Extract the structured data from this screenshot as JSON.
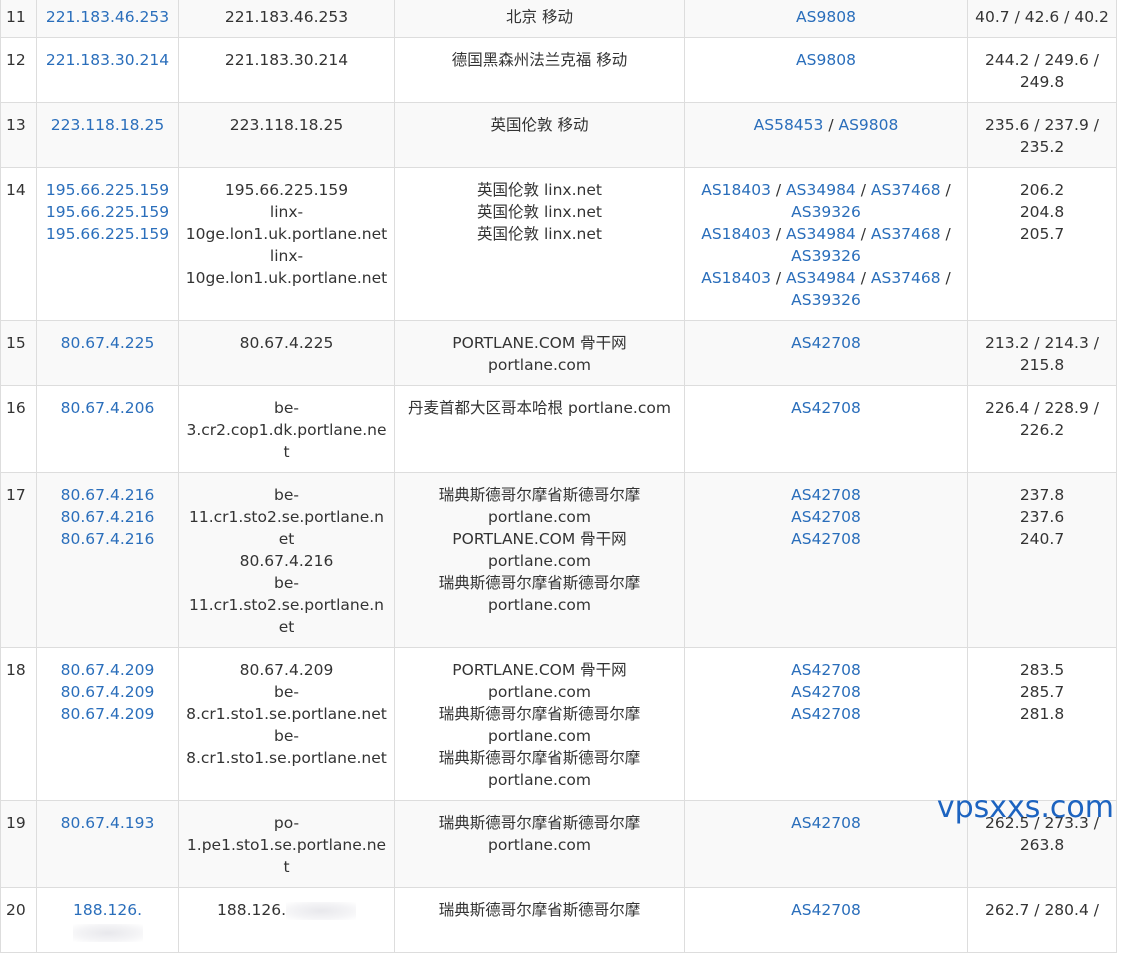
{
  "rows": [
    {
      "hop": "11",
      "ips": [
        "221.183.46.253"
      ],
      "hosts": [
        "221.183.46.253"
      ],
      "geo": [
        "北京 移动"
      ],
      "asn": [
        [
          "AS9808"
        ]
      ],
      "rtt": [
        "40.7 / 42.6 / 40.2"
      ]
    },
    {
      "hop": "12",
      "ips": [
        "221.183.30.214"
      ],
      "hosts": [
        "221.183.30.214"
      ],
      "geo": [
        "德国黑森州法兰克福 移动"
      ],
      "asn": [
        [
          "AS9808"
        ]
      ],
      "rtt": [
        "244.2 / 249.6 / 249.8"
      ]
    },
    {
      "hop": "13",
      "ips": [
        "223.118.18.25"
      ],
      "hosts": [
        "223.118.18.25"
      ],
      "geo": [
        "英国伦敦 移动"
      ],
      "asn": [
        [
          "AS58453",
          "AS9808"
        ]
      ],
      "rtt": [
        "235.6 / 237.9 / 235.2"
      ]
    },
    {
      "hop": "14",
      "ips": [
        "195.66.225.159",
        "195.66.225.159",
        "195.66.225.159"
      ],
      "hosts": [
        "195.66.225.159",
        "linx-10ge.lon1.uk.portlane.net",
        "linx-10ge.lon1.uk.portlane.net"
      ],
      "geo": [
        "英国伦敦 linx.net",
        "英国伦敦 linx.net",
        "英国伦敦 linx.net"
      ],
      "asn": [
        [
          "AS18403",
          "AS34984",
          "AS37468",
          "AS39326"
        ],
        [
          "AS18403",
          "AS34984",
          "AS37468",
          "AS39326"
        ],
        [
          "AS18403",
          "AS34984",
          "AS37468",
          "AS39326"
        ]
      ],
      "rtt": [
        "206.2",
        "204.8",
        "205.7"
      ]
    },
    {
      "hop": "15",
      "ips": [
        "80.67.4.225"
      ],
      "hosts": [
        "80.67.4.225"
      ],
      "geo": [
        "PORTLANE.COM 骨干网 portlane.com"
      ],
      "asn": [
        [
          "AS42708"
        ]
      ],
      "rtt": [
        "213.2 / 214.3 / 215.8"
      ]
    },
    {
      "hop": "16",
      "ips": [
        "80.67.4.206"
      ],
      "hosts": [
        "be-3.cr2.cop1.dk.portlane.net"
      ],
      "geo": [
        "丹麦首都大区哥本哈根 portlane.com"
      ],
      "asn": [
        [
          "AS42708"
        ]
      ],
      "rtt": [
        "226.4 / 228.9 / 226.2"
      ]
    },
    {
      "hop": "17",
      "ips": [
        "80.67.4.216",
        "80.67.4.216",
        "80.67.4.216"
      ],
      "hosts": [
        "be-11.cr1.sto2.se.portlane.net",
        "80.67.4.216",
        "be-11.cr1.sto2.se.portlane.net"
      ],
      "geo": [
        "瑞典斯德哥尔摩省斯德哥尔摩 portlane.com",
        "PORTLANE.COM 骨干网 portlane.com",
        "瑞典斯德哥尔摩省斯德哥尔摩 portlane.com"
      ],
      "asn": [
        [
          "AS42708"
        ],
        [
          "AS42708"
        ],
        [
          "AS42708"
        ]
      ],
      "rtt": [
        "237.8",
        "237.6",
        "240.7"
      ]
    },
    {
      "hop": "18",
      "ips": [
        "80.67.4.209",
        "80.67.4.209",
        "80.67.4.209"
      ],
      "hosts": [
        "80.67.4.209",
        "be-8.cr1.sto1.se.portlane.net",
        "be-8.cr1.sto1.se.portlane.net"
      ],
      "geo": [
        "PORTLANE.COM 骨干网 portlane.com",
        "瑞典斯德哥尔摩省斯德哥尔摩 portlane.com",
        "瑞典斯德哥尔摩省斯德哥尔摩 portlane.com"
      ],
      "asn": [
        [
          "AS42708"
        ],
        [
          "AS42708"
        ],
        [
          "AS42708"
        ]
      ],
      "rtt": [
        "283.5",
        "285.7",
        "281.8"
      ]
    },
    {
      "hop": "19",
      "ips": [
        "80.67.4.193"
      ],
      "hosts": [
        "po-1.pe1.sto1.se.portlane.net"
      ],
      "geo": [
        "瑞典斯德哥尔摩省斯德哥尔摩 portlane.com"
      ],
      "asn": [
        [
          "AS42708"
        ]
      ],
      "rtt": [
        "262.5 / 273.3 / 263.8"
      ]
    },
    {
      "hop": "20",
      "ips": [
        "188.126."
      ],
      "hosts": [
        "188.126."
      ],
      "geo": [
        "瑞典斯德哥尔摩省斯德哥尔摩"
      ],
      "asn": [
        [
          "AS42708"
        ]
      ],
      "rtt": [
        "262.7 / 280.4 /"
      ],
      "redacted": true
    }
  ],
  "asn_separator": " / ",
  "watermark": "vpsxxs.com"
}
